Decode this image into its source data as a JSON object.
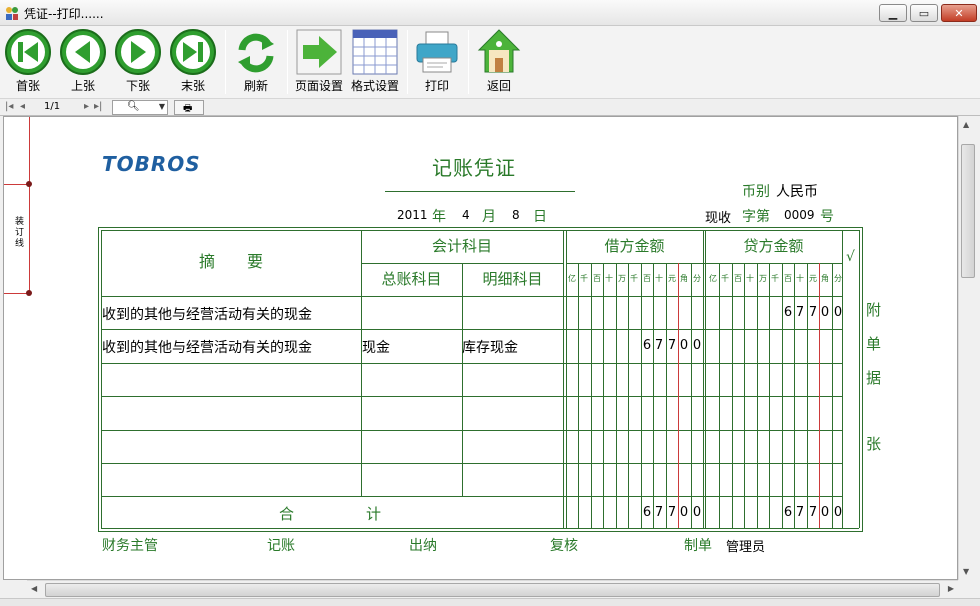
{
  "window": {
    "title": "凭证--打印......"
  },
  "toolbar": {
    "first": "首张",
    "prev": "上张",
    "next": "下张",
    "last": "末张",
    "refresh": "刷新",
    "page_setup": "页面设置",
    "format_setup": "格式设置",
    "print": "打印",
    "back": "返回"
  },
  "nav": {
    "page": "1/1"
  },
  "voucher": {
    "logo": "TOBROS",
    "title": "记账凭证",
    "currency_label": "币别",
    "currency_value": "人民币",
    "year_value": "2011",
    "year_label": "年",
    "month_value": "4",
    "month_label": "月",
    "day_value": "8",
    "day_label": "日",
    "word_value": "现收",
    "word_label": "字第",
    "number_value": "0009",
    "number_label": "号",
    "binding_label": "装订线",
    "headers": {
      "summary": "摘　　要",
      "account": "会计科目",
      "general": "总账科目",
      "detail": "明细科目",
      "debit": "借方金额",
      "credit": "贷方金额",
      "check": "√"
    },
    "digit_units": [
      "亿",
      "千",
      "百",
      "十",
      "万",
      "千",
      "百",
      "十",
      "元",
      "角",
      "分"
    ],
    "rows": [
      {
        "summary": "收到的其他与经营活动有关的现金",
        "general": "",
        "detail": "",
        "debit": "",
        "credit": "67700"
      },
      {
        "summary": "收到的其他与经营活动有关的现金",
        "general": "现金",
        "detail": "库存现金",
        "debit": "67700",
        "credit": ""
      },
      {
        "summary": "",
        "general": "",
        "detail": "",
        "debit": "",
        "credit": ""
      },
      {
        "summary": "",
        "general": "",
        "detail": "",
        "debit": "",
        "credit": ""
      },
      {
        "summary": "",
        "general": "",
        "detail": "",
        "debit": "",
        "credit": ""
      },
      {
        "summary": "",
        "general": "",
        "detail": "",
        "debit": "",
        "credit": ""
      }
    ],
    "total_label_1": "合",
    "total_label_2": "计",
    "total_debit": "67700",
    "total_credit": "67700",
    "attach": [
      "附",
      "单",
      "据",
      "张"
    ],
    "footer": {
      "finance": "财务主管",
      "bookkeeping": "记账",
      "cashier": "出纳",
      "review": "复核",
      "maker_label": "制单",
      "maker": "管理员"
    }
  },
  "colors": {
    "voucher_green": "#2a7a2a",
    "line_red": "#cc3a3a",
    "logo_blue": "#1f5fa0"
  }
}
